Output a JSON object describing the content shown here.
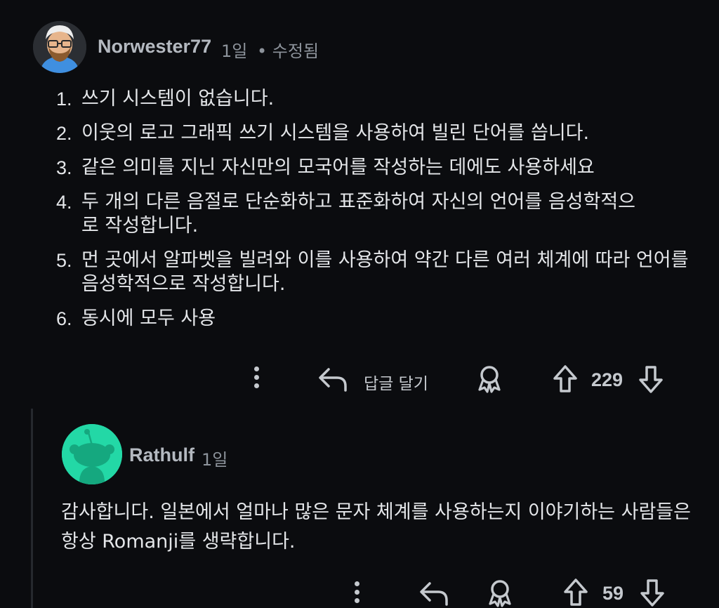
{
  "comment1": {
    "username": "Norwester77",
    "age": "1일",
    "edited": "• 수정됨",
    "items": [
      {
        "num": "1.",
        "text": "쓰기 시스템이 없습니다."
      },
      {
        "num": "2.",
        "text": "이웃의 로고 그래픽 쓰기 시스템을 사용하여 빌린 단어를 씁니다."
      },
      {
        "num": "3.",
        "text": "같은 의미를 지닌 자신만의 모국어를 작성하는 데에도 사용하세요"
      },
      {
        "num": "4.",
        "text": "두 개의 다른 음절로 단순화하고 표준화하여 자신의 언어를 음성학적으로 작성합니다."
      },
      {
        "num": "5.",
        "text": "먼 곳에서 알파벳을 빌려와 이를 사용하여 약간 다른 여러 체계에 따라 언어를 음성학적으로 작성합니다."
      },
      {
        "num": "6.",
        "text": "동시에 모두 사용"
      }
    ],
    "reply_label": "답글 달기",
    "votes": "229"
  },
  "comment2": {
    "username": "Rathulf",
    "age": "1일",
    "text": "감사합니다. 일본에서 얼마나 많은 문자 체계를 사용하는지 이야기하는 사람들은 항상 Romanji를 생략합니다.",
    "votes": "59"
  },
  "icons": {
    "more": "more-vertical-icon",
    "reply": "reply-arrow-icon",
    "award": "award-icon",
    "upvote": "upvote-arrow-icon",
    "downvote": "downvote-arrow-icon"
  },
  "colors": {
    "background": "#0b0c0f",
    "text": "#e4e6e9",
    "muted": "#8d939b",
    "snoo_avatar": "#23d8a6"
  }
}
